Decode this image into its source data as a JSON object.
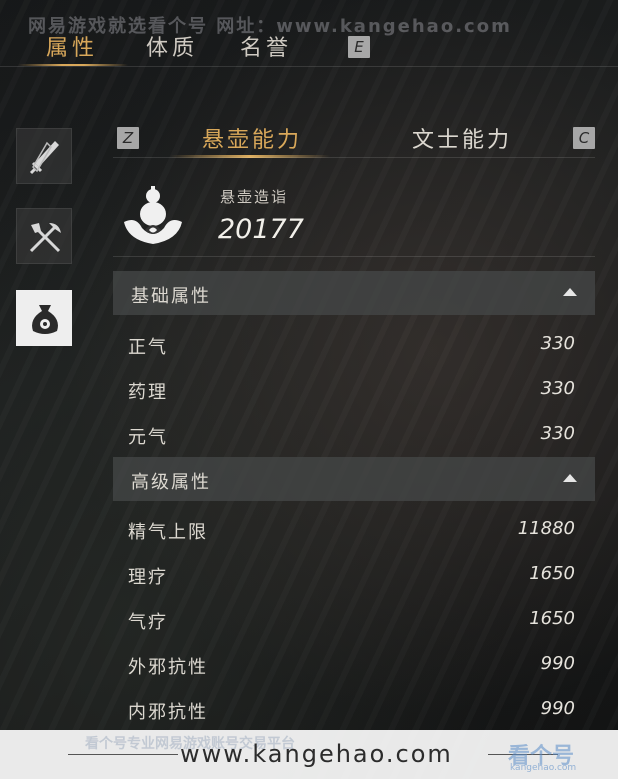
{
  "watermark": {
    "top_text": "网易游戏就选看个号   网址：www.kangehao.com",
    "footer_ghost": "看个号专业网易游戏账号交易平台",
    "footer_url": "www.kangehao.com",
    "footer_logo": "看个号",
    "footer_logo_sub": "kangehao.com"
  },
  "top_tabs": [
    {
      "label": "属性",
      "active": true
    },
    {
      "label": "体质",
      "active": false
    },
    {
      "label": "名誉",
      "active": false
    }
  ],
  "keys": {
    "top_next": "E",
    "sub_prev": "Z",
    "sub_next": "C"
  },
  "side_icons": [
    "sword-icon",
    "shovel-pickaxe-icon",
    "money-bag-icon"
  ],
  "sub_tabs": [
    {
      "label": "悬壶能力",
      "active": true
    },
    {
      "label": "文士能力",
      "active": false
    }
  ],
  "skill": {
    "label": "悬壶造诣",
    "value": "20177"
  },
  "sections": [
    {
      "title": "基础属性",
      "rows": [
        {
          "name": "正气",
          "value": "330"
        },
        {
          "name": "药理",
          "value": "330"
        },
        {
          "name": "元气",
          "value": "330"
        }
      ]
    },
    {
      "title": "高级属性",
      "rows": [
        {
          "name": "精气上限",
          "value": "11880"
        },
        {
          "name": "理疗",
          "value": "1650"
        },
        {
          "name": "气疗",
          "value": "1650"
        },
        {
          "name": "外邪抗性",
          "value": "990"
        },
        {
          "name": "内邪抗性",
          "value": "990"
        }
      ]
    }
  ],
  "colors": {
    "accent": "#d9a85a",
    "panel": "#464848"
  }
}
